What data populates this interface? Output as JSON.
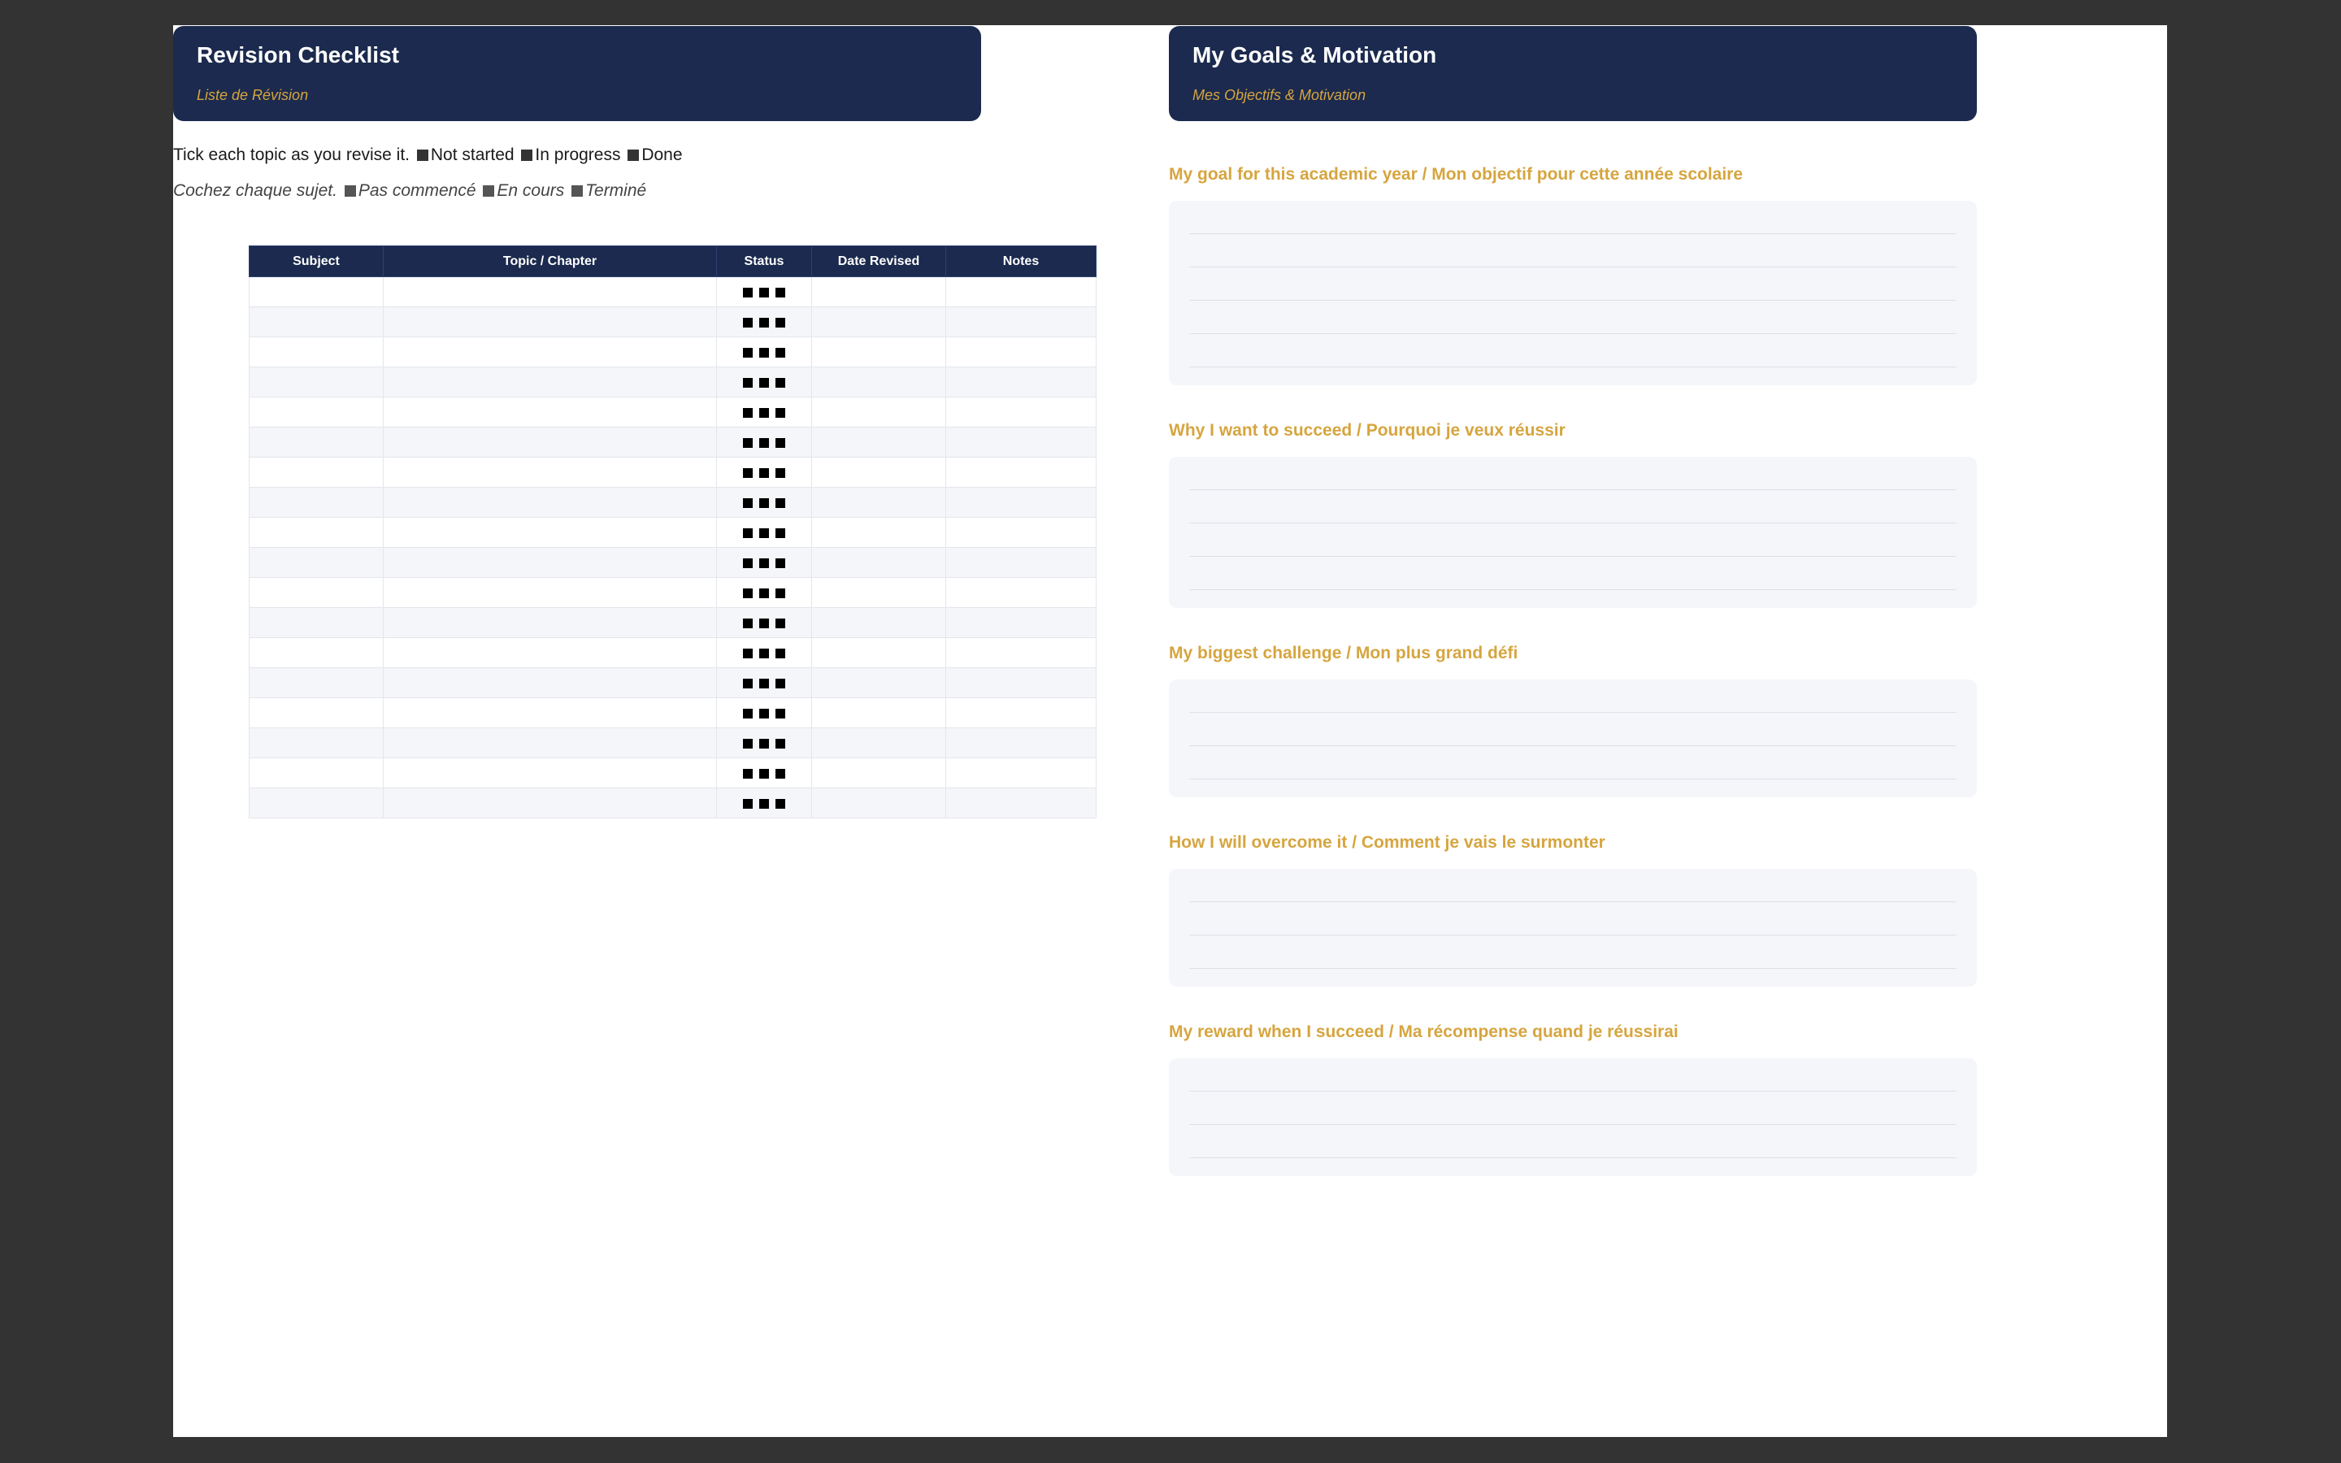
{
  "checklist": {
    "title": "Revision Checklist",
    "subtitle": "Liste de Révision",
    "legend_en": {
      "intro": "Tick each topic as you revise it.",
      "not_started": "Not started",
      "in_progress": "In progress",
      "done": "Done"
    },
    "legend_fr": {
      "intro": "Cochez chaque sujet.",
      "not_started": "Pas commencé",
      "in_progress": "En cours",
      "done": "Terminé"
    },
    "columns": [
      "Subject",
      "Topic / Chapter",
      "Status",
      "Date Revised",
      "Notes"
    ],
    "row_count": 18
  },
  "goals": {
    "title": "My Goals & Motivation",
    "subtitle": "Mes Objectifs & Motivation",
    "sections": [
      {
        "label": "My goal for this academic year / Mon objectif pour cette année scolaire",
        "lines": 5
      },
      {
        "label": "Why I want to succeed / Pourquoi je veux réussir",
        "lines": 4
      },
      {
        "label": "My biggest challenge / Mon plus grand défi",
        "lines": 3
      },
      {
        "label": "How I will overcome it / Comment je vais le surmonter",
        "lines": 3
      },
      {
        "label": "My reward when I succeed / Ma récompense quand je réussirai",
        "lines": 3
      }
    ]
  },
  "colors": {
    "navy": "#1b2a4e",
    "gold": "#d6a53f",
    "box_fill": "#f4f6f9"
  }
}
